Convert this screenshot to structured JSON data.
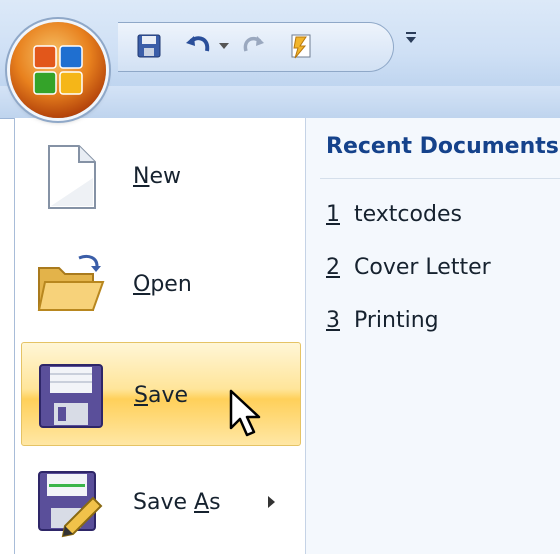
{
  "quick_access": {
    "icons": [
      "save-icon",
      "undo-icon",
      "redo-icon",
      "repeat-format-icon",
      "customize-toolbar-icon"
    ]
  },
  "menu": {
    "items": [
      {
        "label": "New",
        "mnemonic": "N",
        "rest": "ew",
        "icon": "new-document-icon"
      },
      {
        "label": "Open",
        "mnemonic": "O",
        "rest": "pen",
        "icon": "open-folder-icon"
      },
      {
        "label": "Save",
        "mnemonic": "S",
        "rest": "ave",
        "icon": "floppy-disk-icon",
        "highlighted": true
      },
      {
        "label": "Save As",
        "prefix": "Save ",
        "mnemonic": "A",
        "rest": "s",
        "icon": "save-as-icon",
        "has_submenu": true
      }
    ]
  },
  "recent": {
    "title": "Recent Documents",
    "documents": [
      {
        "number": "1",
        "name": "textcodes"
      },
      {
        "number": "2",
        "name": "Cover Letter"
      },
      {
        "number": "3",
        "name": "Printing"
      }
    ]
  },
  "colors": {
    "highlight": "#ffd05a",
    "title_blue": "#15428b",
    "ribbon": "#c1d6f0"
  }
}
